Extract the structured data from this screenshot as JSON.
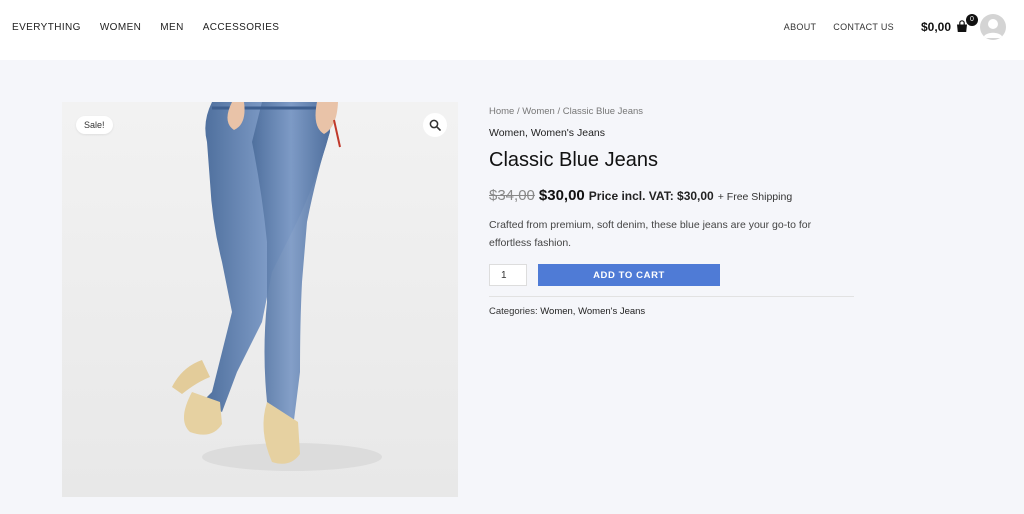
{
  "header": {
    "nav_left": [
      "EVERYTHING",
      "WOMEN",
      "MEN",
      "ACCESSORIES"
    ],
    "nav_right": [
      "ABOUT",
      "CONTACT US"
    ],
    "cart_total": "$0,00",
    "cart_count": "0"
  },
  "product": {
    "sale_badge": "Sale!",
    "breadcrumb": {
      "home": "Home",
      "sep1": " / ",
      "category": "Women",
      "sep2": " / ",
      "current": "Classic Blue Jeans"
    },
    "categories_top": "Women, Women's Jeans",
    "title": "Classic Blue Jeans",
    "price_old": "$34,00",
    "price_new": "$30,00",
    "price_vat": "Price incl. VAT: $30,00",
    "shipping": "+ Free Shipping",
    "description": "Crafted from premium, soft denim, these blue jeans are your go-to for effortless fashion.",
    "quantity": "1",
    "add_to_cart": "ADD TO CART",
    "categories_label": "Categories:",
    "categories_value": "Women, Women's Jeans"
  },
  "icons": {
    "zoom": "magnifier-icon",
    "cart": "shopping-bag-icon",
    "avatar": "user-avatar-icon"
  },
  "colors": {
    "accent": "#4f7bd6",
    "background": "#f5f6fa"
  }
}
